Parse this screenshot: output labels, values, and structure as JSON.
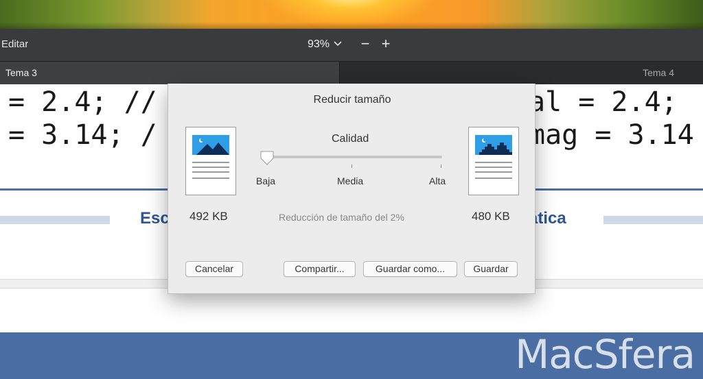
{
  "toolbar": {
    "edit_menu": "Editar",
    "zoom_value": "93%",
    "zoom_chevron_icon": "chevron-down-icon",
    "zoom_out_icon": "minus-icon",
    "zoom_in_icon": "plus-icon",
    "zoom_out_glyph": "−",
    "zoom_in_glyph": "+"
  },
  "tabs": [
    {
      "label": "Tema 3",
      "active": true
    },
    {
      "label": "Tema 4",
      "active": false
    }
  ],
  "document": {
    "code_line_1_left": "= 2.4; //",
    "code_line_2_left": "= 3.14; /",
    "code_line_1_right": "al = 2.4;",
    "code_line_2_right": "mag = 3.14",
    "heading_left": "Esc",
    "heading_right": "ática",
    "watermark": "MacSfera",
    "bottom_peek_left": "l  l",
    "bottom_peek_right": "l"
  },
  "dialog": {
    "title": "Reducir tamaño",
    "quality_label": "Calidad",
    "scale_low": "Baja",
    "scale_mid": "Media",
    "scale_high": "Alta",
    "quality_level_fraction": 0.0,
    "original_size": "492 KB",
    "new_size": "480 KB",
    "reduction_text": "Reducción de tamaño del 2%",
    "buttons": {
      "cancel": "Cancelar",
      "share": "Compartir...",
      "save_as": "Guardar como...",
      "save": "Guardar"
    }
  },
  "colors": {
    "toolbar_bg": "#3a3b3c",
    "accent_blue": "#2f5597",
    "thumb_image_blue": "#2e9ee6"
  }
}
